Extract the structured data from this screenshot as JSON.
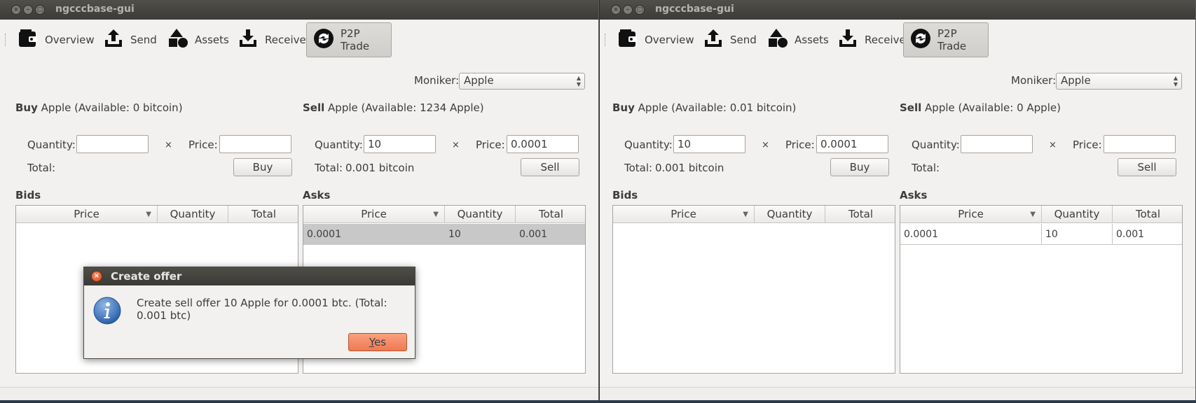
{
  "left": {
    "window_title": "ngcccbase-gui",
    "toolbar": [
      {
        "label": "Overview",
        "icon": "wallet-icon"
      },
      {
        "label": "Send",
        "icon": "upload-tray-icon"
      },
      {
        "label": "Assets",
        "icon": "shapes-icon"
      },
      {
        "label": "Receive",
        "icon": "download-tray-icon"
      },
      {
        "label": "P2P Trade",
        "icon": "refresh-circle-icon",
        "active": true
      }
    ],
    "moniker_label": "Moniker:",
    "moniker_value": "Apple",
    "buy": {
      "heading_bold": "Buy",
      "heading_rest": "Apple (Available: 0 bitcoin)",
      "quantity_label": "Quantity:",
      "quantity_value": "",
      "times": "×",
      "price_label": "Price:",
      "price_value": "",
      "total_label": "Total:",
      "total_value": "",
      "button": "Buy"
    },
    "sell": {
      "heading_bold": "Sell",
      "heading_rest": "Apple (Available: 1234 Apple)",
      "quantity_label": "Quantity:",
      "quantity_value": "10",
      "times": "×",
      "price_label": "Price:",
      "price_value": "0.0001",
      "total_label": "Total:",
      "total_value": "0.001 bitcoin",
      "button": "Sell"
    },
    "bids": {
      "title": "Bids",
      "columns": [
        "Price",
        "Quantity",
        "Total"
      ],
      "rows": []
    },
    "asks": {
      "title": "Asks",
      "columns": [
        "Price",
        "Quantity",
        "Total"
      ],
      "rows": [
        [
          "0.0001",
          "10",
          "0.001"
        ]
      ]
    },
    "dialog": {
      "title": "Create offer",
      "message": "Create sell offer 10 Apple for 0.0001 btc. (Total: 0.001 btc)",
      "yes_prefix": "",
      "yes_mnemonic": "Y",
      "yes_suffix": "es"
    }
  },
  "right": {
    "window_title": "ngcccbase-gui",
    "toolbar": [
      {
        "label": "Overview",
        "icon": "wallet-icon"
      },
      {
        "label": "Send",
        "icon": "upload-tray-icon"
      },
      {
        "label": "Assets",
        "icon": "shapes-icon"
      },
      {
        "label": "Receive",
        "icon": "download-tray-icon"
      },
      {
        "label": "P2P Trade",
        "icon": "refresh-circle-icon",
        "active": true
      }
    ],
    "moniker_label": "Moniker:",
    "moniker_value": "Apple",
    "buy": {
      "heading_bold": "Buy",
      "heading_rest": "Apple (Available: 0.01 bitcoin)",
      "quantity_label": "Quantity:",
      "quantity_value": "10",
      "times": "×",
      "price_label": "Price:",
      "price_value": "0.0001",
      "total_label": "Total:",
      "total_value": "0.001 bitcoin",
      "button": "Buy"
    },
    "sell": {
      "heading_bold": "Sell",
      "heading_rest": "Apple (Available: 0 Apple)",
      "quantity_label": "Quantity:",
      "quantity_value": "",
      "times": "×",
      "price_label": "Price:",
      "price_value": "",
      "total_label": "Total:",
      "total_value": "",
      "button": "Sell"
    },
    "bids": {
      "title": "Bids",
      "columns": [
        "Price",
        "Quantity",
        "Total"
      ],
      "rows": []
    },
    "asks": {
      "title": "Asks",
      "columns": [
        "Price",
        "Quantity",
        "Total"
      ],
      "rows": [
        [
          "0.0001",
          "10",
          "0.001"
        ]
      ]
    }
  }
}
